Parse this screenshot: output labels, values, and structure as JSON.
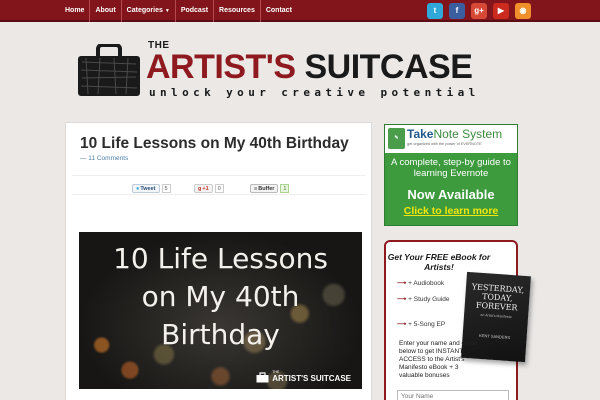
{
  "nav": {
    "items": [
      {
        "label": "Home"
      },
      {
        "label": "About"
      },
      {
        "label": "Categories",
        "has_dropdown": true
      },
      {
        "label": "Podcast"
      },
      {
        "label": "Resources"
      },
      {
        "label": "Contact"
      }
    ],
    "background": "#82151b"
  },
  "social": [
    {
      "icon": "twitter-icon",
      "glyph": "t",
      "color": "#2fa7d9"
    },
    {
      "icon": "facebook-icon",
      "glyph": "f",
      "color": "#3b5ea0"
    },
    {
      "icon": "google-plus-icon",
      "glyph": "g+",
      "color": "#d64937"
    },
    {
      "icon": "youtube-icon",
      "glyph": "▶",
      "color": "#cc2a1f"
    },
    {
      "icon": "rss-icon",
      "glyph": "◉",
      "color": "#f0902a"
    }
  ],
  "logo": {
    "the": "THE",
    "artists": "ARTIST'S",
    "suitcase": "SUITCASE",
    "tagline": "unlock your creative potential"
  },
  "post": {
    "title": "10 Life Lessons on My 40th Birthday",
    "comments": "— 11 Comments",
    "share": {
      "tweet_label": "Tweet",
      "tweet_count": "5",
      "gplus_label": "+1",
      "gplus_count": "0",
      "buffer_label": "Buffer",
      "buffer_count": "1"
    },
    "hero_line1": "10 Life Lessons",
    "hero_line2": "on My 40th",
    "hero_line3": "Birthday",
    "hero_badge_small": "THE",
    "hero_badge": "ARTIST'S SUITCASE"
  },
  "sidebar": {
    "ad1": {
      "title_take": "Take",
      "title_rest": "Note System",
      "subtitle": "get organized with the power of EVERNOTE",
      "description": "A complete, step-by guide to learning Evernote",
      "cta": "Now Available",
      "link": "Click to learn more"
    },
    "ad2": {
      "title": "Get Your FREE eBook for Artists!",
      "items": [
        {
          "arrow": "⟶",
          "text": "+ Audiobook"
        },
        {
          "arrow": "⟶",
          "text": "+ Study Guide"
        },
        {
          "arrow": "⟶",
          "text": "+ 5-Song EP"
        }
      ],
      "body": "Enter your name and email below to get INSTANT ACCESS to the Artist's Manifesto eBook + 3 valuable bonuses",
      "input_placeholder": "Your Name",
      "book_title": "YESTERDAY, TODAY, FOREVER",
      "book_subtitle": "an Artist's Manifesto",
      "book_author": "KENT SANDERS"
    }
  }
}
